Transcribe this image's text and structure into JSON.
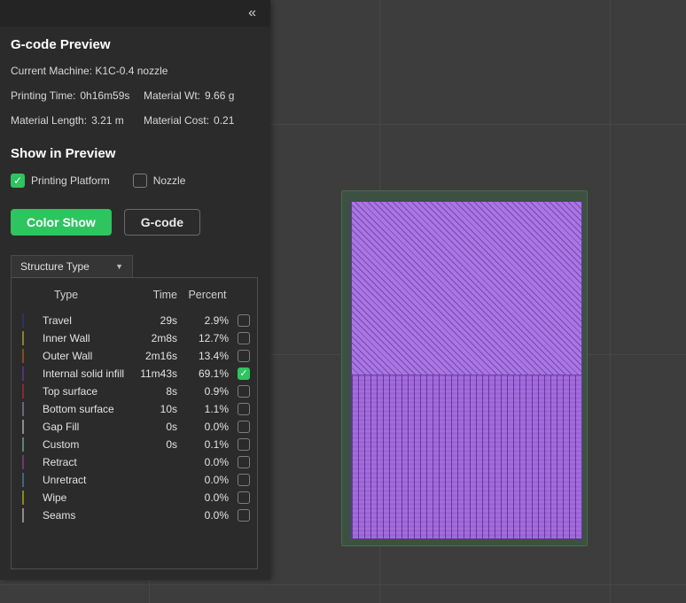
{
  "panel": {
    "collapse_icon": "«",
    "title": "G-code Preview",
    "machine_line": "Current Machine: K1C-0.4 nozzle",
    "stats": {
      "printing_time": {
        "label": "Printing Time:",
        "value": "0h16m59s"
      },
      "material_wt": {
        "label": "Material Wt:",
        "value": "9.66 g"
      },
      "material_length": {
        "label": "Material Length:",
        "value": "3.21 m"
      },
      "material_cost": {
        "label": "Material Cost:",
        "value": "0.21"
      }
    },
    "show_in_preview": {
      "title": "Show in Preview",
      "options": [
        {
          "label": "Printing Platform",
          "checked": true
        },
        {
          "label": "Nozzle",
          "checked": false
        }
      ]
    },
    "buttons": {
      "color_show": "Color Show",
      "gcode": "G-code"
    },
    "structure_dropdown": {
      "label": "Structure Type",
      "caret": "▼"
    },
    "table": {
      "headers": [
        "Type",
        "Time",
        "Percent"
      ],
      "rows": [
        {
          "color": "#4f5cc0",
          "type": "Travel",
          "time": "29s",
          "percent": "2.9%",
          "checked": false
        },
        {
          "color": "#f8ec5a",
          "type": "Inner Wall",
          "time": "2m8s",
          "percent": "12.7%",
          "checked": false
        },
        {
          "color": "#f7863b",
          "type": "Outer Wall",
          "time": "2m16s",
          "percent": "13.4%",
          "checked": false
        },
        {
          "color": "#9c5fd4",
          "type": "Internal solid infill",
          "time": "11m43s",
          "percent": "69.1%",
          "checked": true
        },
        {
          "color": "#ef5058",
          "type": "Top surface",
          "time": "8s",
          "percent": "0.9%",
          "checked": false
        },
        {
          "color": "#c0b8ee",
          "type": "Bottom surface",
          "time": "10s",
          "percent": "1.1%",
          "checked": false
        },
        {
          "color": "#ffffff",
          "type": "Gap Fill",
          "time": "0s",
          "percent": "0.0%",
          "checked": false
        },
        {
          "color": "#b7ecc8",
          "type": "Custom",
          "time": "0s",
          "percent": "0.1%",
          "checked": false
        },
        {
          "color": "#d45fd4",
          "type": "Retract",
          "time": "",
          "percent": "0.0%",
          "checked": false
        },
        {
          "color": "#79b8e8",
          "type": "Unretract",
          "time": "",
          "percent": "0.0%",
          "checked": false
        },
        {
          "color": "#f8f830",
          "type": "Wipe",
          "time": "",
          "percent": "0.0%",
          "checked": false
        },
        {
          "color": "#ffffff",
          "type": "Seams",
          "time": "",
          "percent": "0.0%",
          "checked": false
        }
      ]
    }
  },
  "colors": {
    "accent_green": "#2ec45f",
    "panel_bg": "#2b2b2b",
    "viewport_bg": "#3d3d3d",
    "platform_green": "#3c5141",
    "object_purple_top": "#aa76e4",
    "object_purple_bottom": "#9c64d8"
  }
}
